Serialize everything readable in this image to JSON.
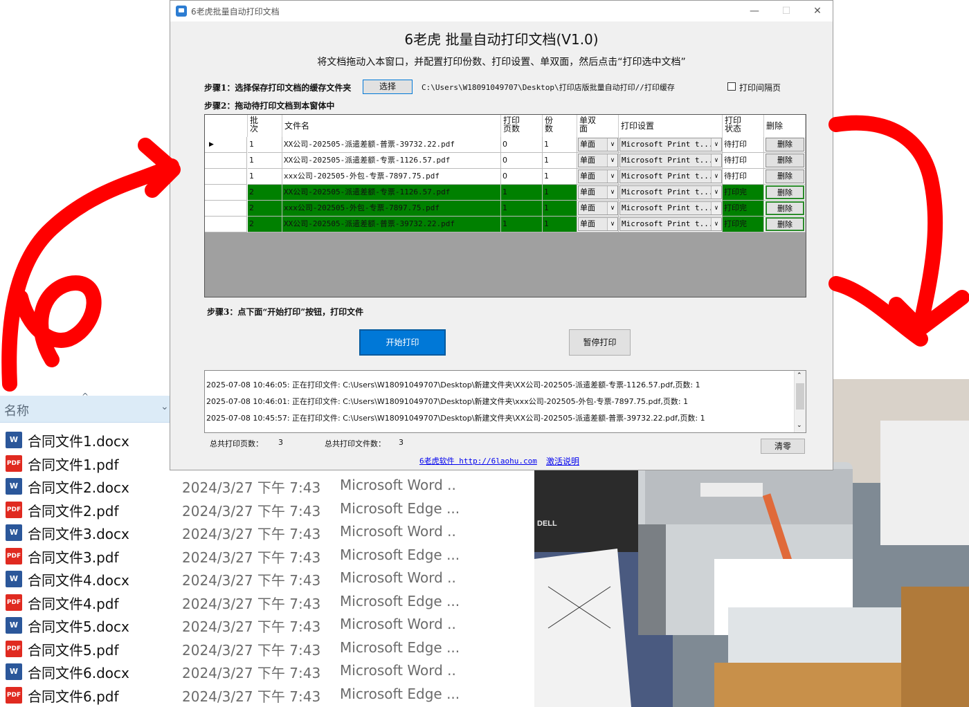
{
  "app": {
    "window_title": "6老虎批量自动打印文档",
    "title": "6老虎 批量自动打印文档(V1.0)",
    "subtitle": "将文档拖动入本窗口，并配置打印份数、打印设置、单双面，然后点击“打印选中文档”",
    "step1_label": "步骤1：选择保存打印文档的缓存文件夹",
    "select_button": "选择",
    "cache_path": "C:\\Users\\W18091049707\\Desktop\\打印店版批量自动打印//打印缓存",
    "interval_checkbox_label": "打印间隔页",
    "step2_label": "步骤2：拖动待打印文档到本窗体中",
    "step3_label": "步骤3：点下面“开始打印”按钮，打印文件",
    "start_button": "开始打印",
    "pause_button": "暂停打印",
    "total_pages_label": "总共打印页数：",
    "total_pages_value": "3",
    "total_files_label": "总共打印文件数：",
    "total_files_value": "3",
    "clear_button": "清零",
    "website_link": "6老虎软件 http://6laohu.com",
    "activation_link": "激活说明"
  },
  "grid": {
    "headers": {
      "batch": "批次",
      "filename": "文件名",
      "pages": "打印页数",
      "copies": "份数",
      "duplex": "单双面",
      "settings": "打印设置",
      "status": "打印状态",
      "delete": "删除"
    },
    "rows": [
      {
        "batch": "1",
        "filename": "XX公司-202505-派遣差额-普票-39732.22.pdf",
        "pages": "0",
        "copies": "1",
        "duplex": "单面",
        "printer": "Microsoft Print t...",
        "status": "待打印",
        "delete": "删除",
        "done": false
      },
      {
        "batch": "1",
        "filename": "XX公司-202505-派遣差额-专票-1126.57.pdf",
        "pages": "0",
        "copies": "1",
        "duplex": "单面",
        "printer": "Microsoft Print t...",
        "status": "待打印",
        "delete": "删除",
        "done": false
      },
      {
        "batch": "1",
        "filename": "xxx公司-202505-外包-专票-7897.75.pdf",
        "pages": "0",
        "copies": "1",
        "duplex": "单面",
        "printer": "Microsoft Print t...",
        "status": "待打印",
        "delete": "删除",
        "done": false
      },
      {
        "batch": "2",
        "filename": "XX公司-202505-派遣差额-专票-1126.57.pdf",
        "pages": "1",
        "copies": "1",
        "duplex": "单面",
        "printer": "Microsoft Print t...",
        "status": "打印完",
        "delete": "删除",
        "done": true
      },
      {
        "batch": "2",
        "filename": "xxx公司-202505-外包-专票-7897.75.pdf",
        "pages": "1",
        "copies": "1",
        "duplex": "单面",
        "printer": "Microsoft Print t...",
        "status": "打印完",
        "delete": "删除",
        "done": true
      },
      {
        "batch": "2",
        "filename": "XX公司-202505-派遣差额-普票-39732.22.pdf",
        "pages": "1",
        "copies": "1",
        "duplex": "单面",
        "printer": "Microsoft Print t...",
        "status": "打印完",
        "delete": "删除",
        "done": true
      }
    ]
  },
  "log": [
    "2025-07-08 10:46:05: 正在打印文件: C:\\Users\\W18091049707\\Desktop\\新建文件夹\\XX公司-202505-派遣差额-专票-1126.57.pdf,页数: 1",
    "2025-07-08 10:46:01: 正在打印文件: C:\\Users\\W18091049707\\Desktop\\新建文件夹\\xxx公司-202505-外包-专票-7897.75.pdf,页数: 1",
    "2025-07-08 10:45:57: 正在打印文件: C:\\Users\\W18091049707\\Desktop\\新建文件夹\\XX公司-202505-派遣差额-普票-39732.22.pdf,页数: 1"
  ],
  "explorer": {
    "column_name": "名称",
    "files": [
      {
        "name": "合同文件1.docx",
        "type_icon": "word-icon",
        "date": "",
        "type": ""
      },
      {
        "name": "合同文件1.pdf",
        "type_icon": "pdf-icon",
        "date": "",
        "type": ""
      },
      {
        "name": "合同文件2.docx",
        "type_icon": "word-icon",
        "date": "2024/3/27 下午 7:43",
        "type": "Microsoft Word .."
      },
      {
        "name": "合同文件2.pdf",
        "type_icon": "pdf-icon",
        "date": "2024/3/27 下午 7:43",
        "type": "Microsoft Edge ..."
      },
      {
        "name": "合同文件3.docx",
        "type_icon": "word-icon",
        "date": "2024/3/27 下午 7:43",
        "type": "Microsoft Word .."
      },
      {
        "name": "合同文件3.pdf",
        "type_icon": "pdf-icon",
        "date": "2024/3/27 下午 7:43",
        "type": "Microsoft Edge ..."
      },
      {
        "name": "合同文件4.docx",
        "type_icon": "word-icon",
        "date": "2024/3/27 下午 7:43",
        "type": "Microsoft Word .."
      },
      {
        "name": "合同文件4.pdf",
        "type_icon": "pdf-icon",
        "date": "2024/3/27 下午 7:43",
        "type": "Microsoft Edge ..."
      },
      {
        "name": "合同文件5.docx",
        "type_icon": "word-icon",
        "date": "2024/3/27 下午 7:43",
        "type": "Microsoft Word .."
      },
      {
        "name": "合同文件5.pdf",
        "type_icon": "pdf-icon",
        "date": "2024/3/27 下午 7:43",
        "type": "Microsoft Edge ..."
      },
      {
        "name": "合同文件6.docx",
        "type_icon": "word-icon",
        "date": "2024/3/27 下午 7:43",
        "type": "Microsoft Word .."
      },
      {
        "name": "合同文件6.pdf",
        "type_icon": "pdf-icon",
        "date": "2024/3/27 下午 7:43",
        "type": "Microsoft Edge ..."
      }
    ]
  },
  "photo": {
    "dell_label": "DELL"
  },
  "colors": {
    "arrow_red": "#ff0000",
    "done_row_green": "#008000",
    "primary_blue": "#0078d7"
  }
}
